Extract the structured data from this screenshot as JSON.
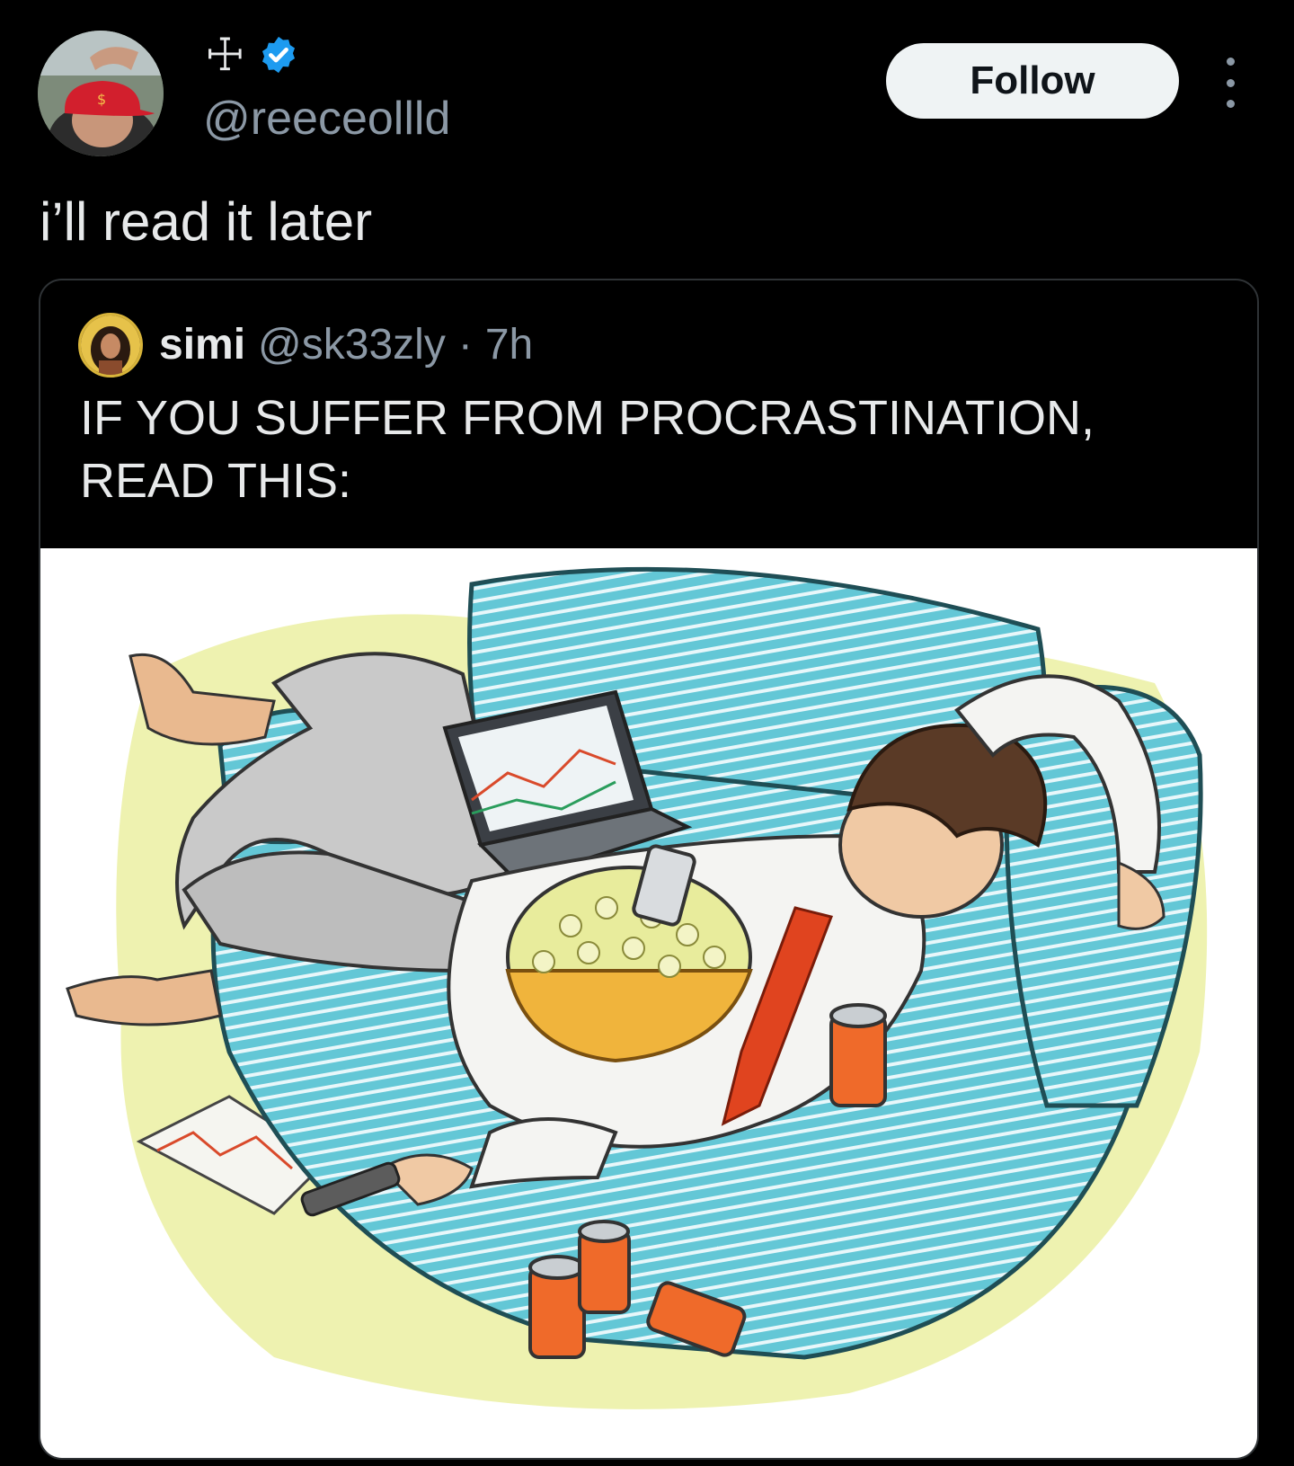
{
  "author": {
    "display_name": "☩",
    "handle": "@reeceollld",
    "avatar_icon": "profile-photo-red-cap"
  },
  "actions": {
    "follow_label": "Follow",
    "more_icon": "more-vertical-icon"
  },
  "tweet": {
    "text": "i’ll read it later"
  },
  "quote": {
    "display_name": "simi",
    "handle": "@sk33zly",
    "separator": "·",
    "time": "7h",
    "text": "IF YOU SUFFER FROM PROCRASTINATION, READ THIS:",
    "image_icon": "illustration-man-on-couch-procrastinating"
  },
  "colors": {
    "background": "#000000",
    "verified_badge": "#1d9bf0",
    "follow_button": "#eff3f4",
    "secondary_text": "#8b98a5",
    "couch": "#5cc3d3"
  }
}
